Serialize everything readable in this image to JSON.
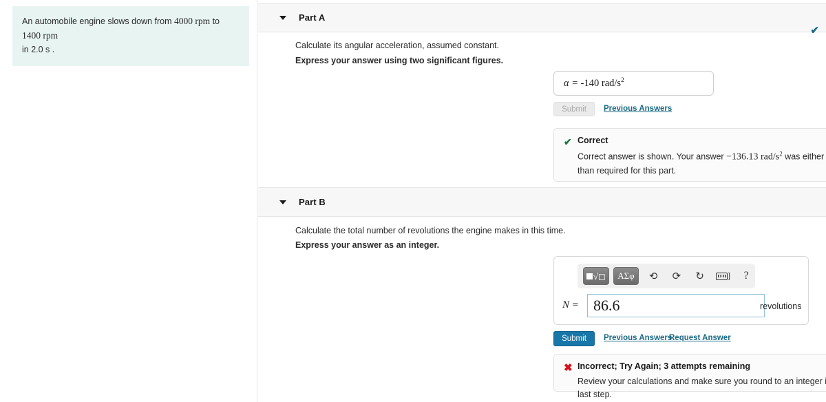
{
  "problem": {
    "text_part1": "An automobile engine slows down from ",
    "rpm_from": "4000 rpm",
    "text_mid": " to ",
    "rpm_to": "1400 rpm",
    "text_end": "in 2.0 s ."
  },
  "parts": [
    {
      "id": "part-a",
      "title": "Part A",
      "status_icon": "check-icon",
      "prompt": "Calculate its angular acceleration, assumed constant.",
      "instruction": "Express your answer using two significant figures.",
      "answer_label": "α = ",
      "answer_value": "-140",
      "answer_units": "rad/s",
      "answer_units_exp": "2",
      "submit_label": "Submit",
      "submit_enabled": false,
      "links": [
        "Previous Answers"
      ],
      "feedback": {
        "type": "correct",
        "mark": "✔",
        "title": "Correct",
        "body_part1": "Correct answer is shown. Your answer ",
        "body_math": "−136.13 rad/s",
        "body_math_exp": "2",
        "body_part2": " was either rounded differently or used a different number of significant figures than required for this part."
      }
    },
    {
      "id": "part-b",
      "title": "Part B",
      "prompt": "Calculate the total number of revolutions the engine makes in this time.",
      "instruction": "Express your answer as an integer.",
      "toolbar": [
        {
          "name": "math-template-button",
          "label": "√"
        },
        {
          "name": "greek-symbols-button",
          "label": "ΑΣφ"
        },
        {
          "name": "undo-icon",
          "label": "↶"
        },
        {
          "name": "redo-icon",
          "label": "↷"
        },
        {
          "name": "reset-icon",
          "label": "↻"
        },
        {
          "name": "keyboard-icon",
          "label": "⌨]"
        },
        {
          "name": "help-icon",
          "label": "?"
        }
      ],
      "answer_label": "N =",
      "answer_value": "86.6",
      "unit": "revolutions",
      "submit_label": "Submit",
      "submit_enabled": true,
      "links": [
        "Previous Answers",
        "Request Answer"
      ],
      "feedback": {
        "type": "incorrect",
        "mark": "✖",
        "title": "Incorrect; Try Again; 3 attempts remaining",
        "body": "Review your calculations and make sure you round to an integer in the last step."
      }
    }
  ],
  "colors": {
    "problem_bg": "#e7f4f2",
    "accent_link": "#1b6a85",
    "submit_active": "#1876a8",
    "correct": "#1a7a3c",
    "incorrect": "#d8101a"
  }
}
